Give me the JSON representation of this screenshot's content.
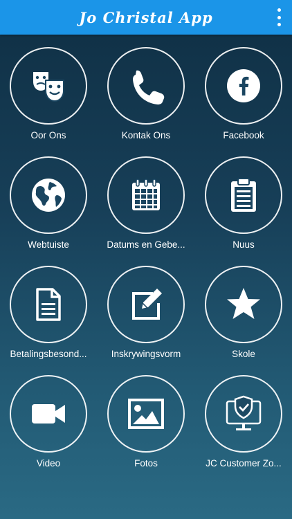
{
  "app": {
    "title": "Jo Christal App"
  },
  "tiles": [
    {
      "label": "Oor Ons",
      "icon": "theater-masks-icon"
    },
    {
      "label": "Kontak Ons",
      "icon": "phone-icon"
    },
    {
      "label": "Facebook",
      "icon": "facebook-icon"
    },
    {
      "label": "Webtuiste",
      "icon": "globe-icon"
    },
    {
      "label": "Datums en Gebe...",
      "icon": "calendar-icon"
    },
    {
      "label": "Nuus",
      "icon": "clipboard-icon"
    },
    {
      "label": "Betalingsbesond...",
      "icon": "document-icon"
    },
    {
      "label": "Inskrywingsvorm",
      "icon": "edit-icon"
    },
    {
      "label": "Skole",
      "icon": "star-icon"
    },
    {
      "label": "Video",
      "icon": "video-camera-icon"
    },
    {
      "label": "Fotos",
      "icon": "image-icon"
    },
    {
      "label": "JC Customer Zo...",
      "icon": "shield-monitor-icon"
    }
  ]
}
